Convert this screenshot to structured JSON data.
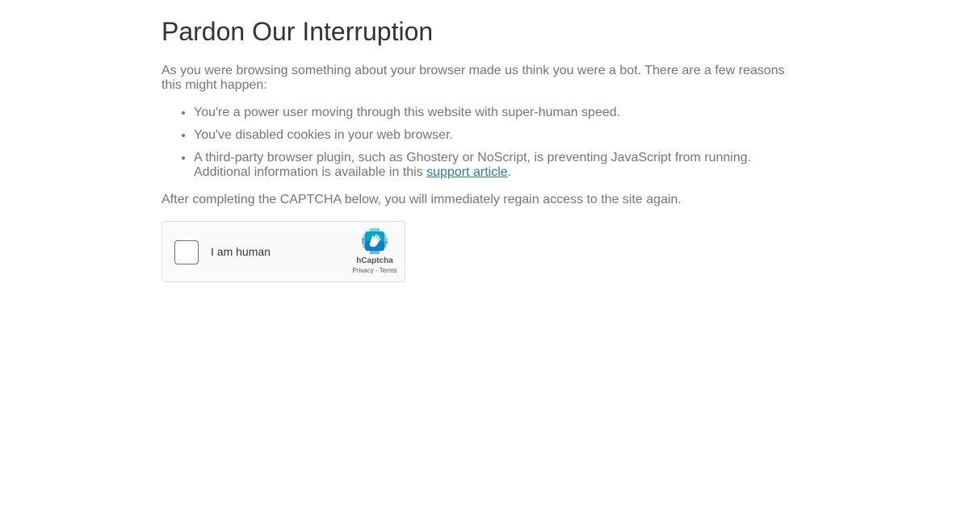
{
  "page": {
    "title": "Pardon Our Interruption",
    "intro": "As you were browsing something about your browser made us think you were a bot. There are a few reasons this might happen:",
    "reasons": [
      "You're a power user moving through this website with super-human speed.",
      "You've disabled cookies in your web browser.",
      "A third-party browser plugin, such as Ghostery or NoScript, is preventing JavaScript from running. Additional information is available in this "
    ],
    "support_link_text": "support article",
    "support_link_suffix": ".",
    "outro": "After completing the CAPTCHA below, you will immediately regain access to the site again."
  },
  "captcha": {
    "checkbox_label": "I am human",
    "brand": "hCaptcha",
    "privacy_link": "Privacy",
    "separator": " - ",
    "terms_link": "Terms",
    "checked": false
  },
  "colors": {
    "link": "#2a7ab0",
    "heading": "#333333",
    "body_text": "#757575",
    "logo_teal": "#00b9c4",
    "logo_blue": "#0074bf"
  },
  "icons": {
    "captcha_logo": "hcaptcha-hand-logo"
  }
}
